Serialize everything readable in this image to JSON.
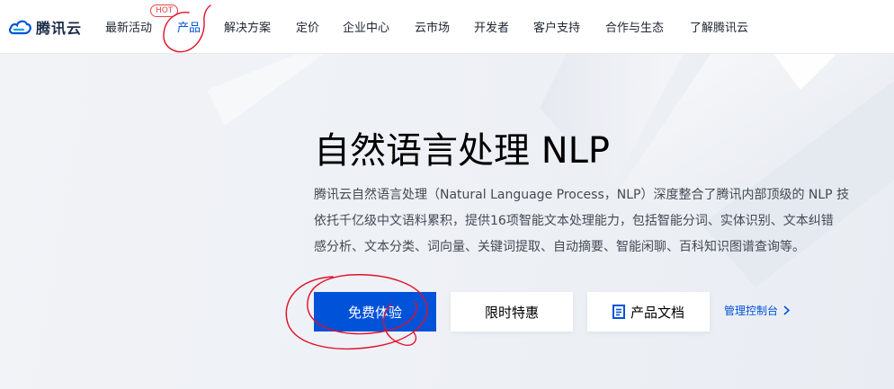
{
  "brand": {
    "name": "腾讯云",
    "logo_icon": "tencent-cloud-logo",
    "color": "#0052d9"
  },
  "nav": {
    "items": [
      {
        "label": "最新活动"
      },
      {
        "label": "产品",
        "active": true,
        "badge": "HOT"
      },
      {
        "label": "解决方案"
      },
      {
        "label": "定价"
      },
      {
        "label": "企业中心"
      },
      {
        "label": "云市场"
      },
      {
        "label": "开发者"
      },
      {
        "label": "客户支持"
      },
      {
        "label": "合作与生态"
      },
      {
        "label": "了解腾讯云"
      }
    ]
  },
  "hero": {
    "title": "自然语言处理 NLP",
    "description_lines": [
      "腾讯云自然语言处理（Natural Language Process，NLP）深度整合了腾讯内部顶级的 NLP 技",
      "依托千亿级中文语料累积，提供16项智能文本处理能力，包括智能分词、实体识别、文本纠错",
      "感分析、文本分类、词向量、关键词提取、自动摘要、智能闲聊、百科知识图谱查询等。"
    ],
    "buttons": {
      "free_trial": "免费体验",
      "limited_offer": "限时特惠",
      "docs": "产品文档",
      "docs_icon": "document-icon",
      "console": "管理控制台",
      "console_icon": "chevron-right-icon"
    }
  },
  "colors": {
    "accent": "#0052d9",
    "hot": "#e54545",
    "annotation": "#e0102a"
  }
}
